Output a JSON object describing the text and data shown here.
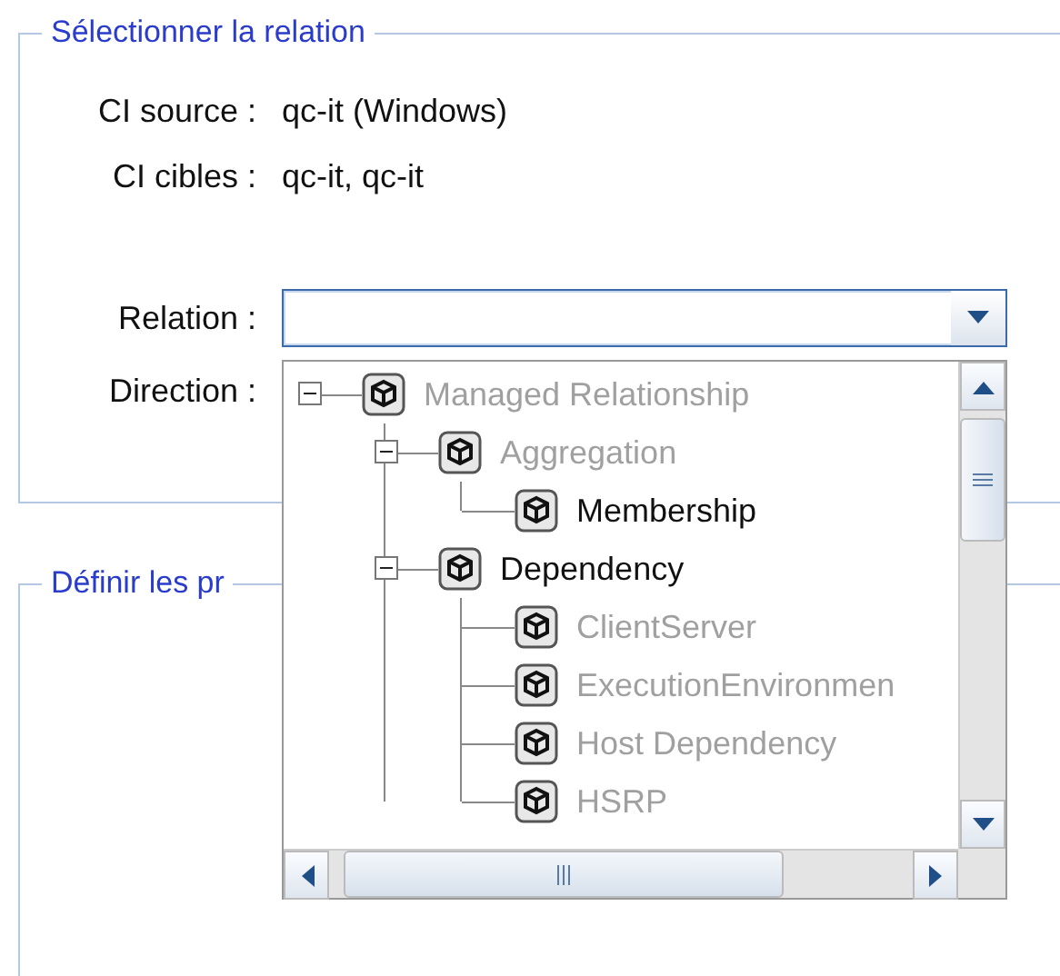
{
  "relation_group": {
    "title": "Sélectionner la relation",
    "fields": [
      {
        "label": "CI source :",
        "value": "qc-it (Windows)"
      },
      {
        "label": "CI cibles :",
        "value": "qc-it, qc-it"
      }
    ],
    "relation": {
      "label": "Relation :",
      "open": true
    },
    "direction": {
      "label": "Direction :"
    }
  },
  "relation_tree": [
    {
      "label": "Managed Relationship",
      "enabled": false,
      "expanded": true,
      "children": [
        {
          "label": "Aggregation",
          "enabled": false,
          "expanded": true,
          "children": [
            {
              "label": "Membership",
              "enabled": true
            }
          ]
        },
        {
          "label": "Dependency",
          "enabled": true,
          "expanded": true,
          "children": [
            {
              "label": "ClientServer",
              "enabled": false
            },
            {
              "label": "ExecutionEnvironmen",
              "enabled": false
            },
            {
              "label": "Host Dependency",
              "enabled": false
            },
            {
              "label": "HSRP",
              "enabled": false
            }
          ]
        }
      ]
    }
  ],
  "properties_group": {
    "title": "Définir les pr"
  }
}
